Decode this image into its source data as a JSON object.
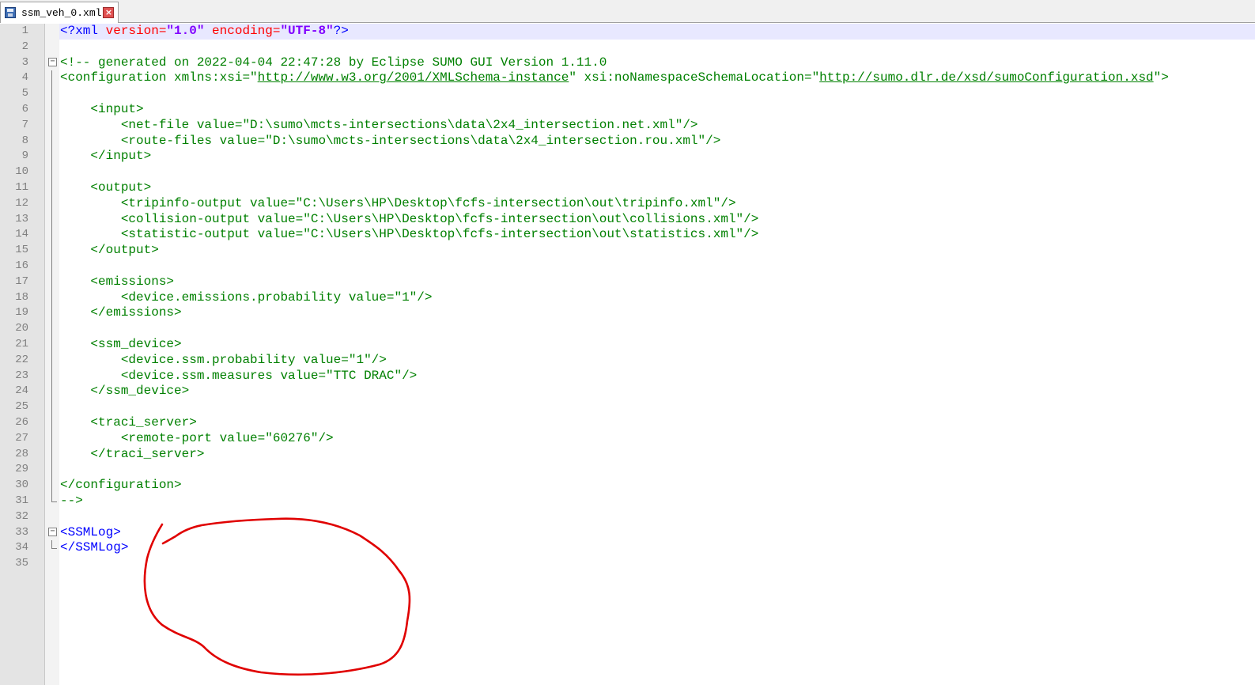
{
  "tab": {
    "filename": "ssm_veh_0.xml"
  },
  "icons": {
    "tab_icon": "save-icon",
    "close": "close-icon"
  },
  "colors": {
    "tag": "#0000ff",
    "attribute": "#ff0000",
    "attr_value": "#8000ff",
    "comment": "#008000",
    "annotation": "#e00000"
  },
  "editor": {
    "lines": [
      {
        "n": "1",
        "fold": "",
        "segments": [
          {
            "s": "<?xml ",
            "c": "tag"
          },
          {
            "s": "version=",
            "c": "attr"
          },
          {
            "s": "\"1.0\"",
            "c": "val"
          },
          {
            "s": " encoding=",
            "c": "attr"
          },
          {
            "s": "\"UTF-8\"",
            "c": "val"
          },
          {
            "s": "?>",
            "c": "tag"
          }
        ]
      },
      {
        "n": "2",
        "fold": "",
        "segments": []
      },
      {
        "n": "3",
        "fold": "open",
        "segments": [
          {
            "s": "<!-- generated on 2022-04-04 22:47:28 by Eclipse SUMO GUI Version 1.11.0",
            "c": "comment"
          }
        ]
      },
      {
        "n": "4",
        "fold": "mid",
        "segments": [
          {
            "s": "<configuration xmlns:xsi=\"",
            "c": "comment"
          },
          {
            "s": "http://www.w3.org/2001/XMLSchema-instance",
            "c": "link"
          },
          {
            "s": "\" xsi:noNamespaceSchemaLocation=\"",
            "c": "comment"
          },
          {
            "s": "http://sumo.dlr.de/xsd/sumoConfiguration.xsd",
            "c": "link"
          },
          {
            "s": "\">",
            "c": "comment"
          }
        ]
      },
      {
        "n": "5",
        "fold": "mid",
        "segments": []
      },
      {
        "n": "6",
        "fold": "mid",
        "segments": [
          {
            "s": "    <input>",
            "c": "comment"
          }
        ]
      },
      {
        "n": "7",
        "fold": "mid",
        "segments": [
          {
            "s": "        <net-file value=\"D:\\sumo\\mcts-intersections\\data\\2x4_intersection.net.xml\"/>",
            "c": "comment"
          }
        ]
      },
      {
        "n": "8",
        "fold": "mid",
        "segments": [
          {
            "s": "        <route-files value=\"D:\\sumo\\mcts-intersections\\data\\2x4_intersection.rou.xml\"/>",
            "c": "comment"
          }
        ]
      },
      {
        "n": "9",
        "fold": "mid",
        "segments": [
          {
            "s": "    </input>",
            "c": "comment"
          }
        ]
      },
      {
        "n": "10",
        "fold": "mid",
        "segments": []
      },
      {
        "n": "11",
        "fold": "mid",
        "segments": [
          {
            "s": "    <output>",
            "c": "comment"
          }
        ]
      },
      {
        "n": "12",
        "fold": "mid",
        "segments": [
          {
            "s": "        <tripinfo-output value=\"C:\\Users\\HP\\Desktop\\fcfs-intersection\\out\\tripinfo.xml\"/>",
            "c": "comment"
          }
        ]
      },
      {
        "n": "13",
        "fold": "mid",
        "segments": [
          {
            "s": "        <collision-output value=\"C:\\Users\\HP\\Desktop\\fcfs-intersection\\out\\collisions.xml\"/>",
            "c": "comment"
          }
        ]
      },
      {
        "n": "14",
        "fold": "mid",
        "segments": [
          {
            "s": "        <statistic-output value=\"C:\\Users\\HP\\Desktop\\fcfs-intersection\\out\\statistics.xml\"/>",
            "c": "comment"
          }
        ]
      },
      {
        "n": "15",
        "fold": "mid",
        "segments": [
          {
            "s": "    </output>",
            "c": "comment"
          }
        ]
      },
      {
        "n": "16",
        "fold": "mid",
        "segments": []
      },
      {
        "n": "17",
        "fold": "mid",
        "segments": [
          {
            "s": "    <emissions>",
            "c": "comment"
          }
        ]
      },
      {
        "n": "18",
        "fold": "mid",
        "segments": [
          {
            "s": "        <device.emissions.probability value=\"1\"/>",
            "c": "comment"
          }
        ]
      },
      {
        "n": "19",
        "fold": "mid",
        "segments": [
          {
            "s": "    </emissions>",
            "c": "comment"
          }
        ]
      },
      {
        "n": "20",
        "fold": "mid",
        "segments": []
      },
      {
        "n": "21",
        "fold": "mid",
        "segments": [
          {
            "s": "    <ssm_device>",
            "c": "comment"
          }
        ]
      },
      {
        "n": "22",
        "fold": "mid",
        "segments": [
          {
            "s": "        <device.ssm.probability value=\"1\"/>",
            "c": "comment"
          }
        ]
      },
      {
        "n": "23",
        "fold": "mid",
        "segments": [
          {
            "s": "        <device.ssm.measures value=\"TTC DRAC\"/>",
            "c": "comment"
          }
        ]
      },
      {
        "n": "24",
        "fold": "mid",
        "segments": [
          {
            "s": "    </ssm_device>",
            "c": "comment"
          }
        ]
      },
      {
        "n": "25",
        "fold": "mid",
        "segments": []
      },
      {
        "n": "26",
        "fold": "mid",
        "segments": [
          {
            "s": "    <traci_server>",
            "c": "comment"
          }
        ]
      },
      {
        "n": "27",
        "fold": "mid",
        "segments": [
          {
            "s": "        <remote-port value=\"60276\"/>",
            "c": "comment"
          }
        ]
      },
      {
        "n": "28",
        "fold": "mid",
        "segments": [
          {
            "s": "    </traci_server>",
            "c": "comment"
          }
        ]
      },
      {
        "n": "29",
        "fold": "mid",
        "segments": []
      },
      {
        "n": "30",
        "fold": "mid",
        "segments": [
          {
            "s": "</configuration>",
            "c": "comment"
          }
        ]
      },
      {
        "n": "31",
        "fold": "end",
        "segments": [
          {
            "s": "-->",
            "c": "comment"
          }
        ]
      },
      {
        "n": "32",
        "fold": "",
        "segments": []
      },
      {
        "n": "33",
        "fold": "open",
        "segments": [
          {
            "s": "<SSMLog>",
            "c": "tag"
          }
        ]
      },
      {
        "n": "34",
        "fold": "end",
        "segments": [
          {
            "s": "</SSMLog>",
            "c": "tag"
          }
        ]
      },
      {
        "n": "35",
        "fold": "",
        "segments": []
      }
    ]
  }
}
